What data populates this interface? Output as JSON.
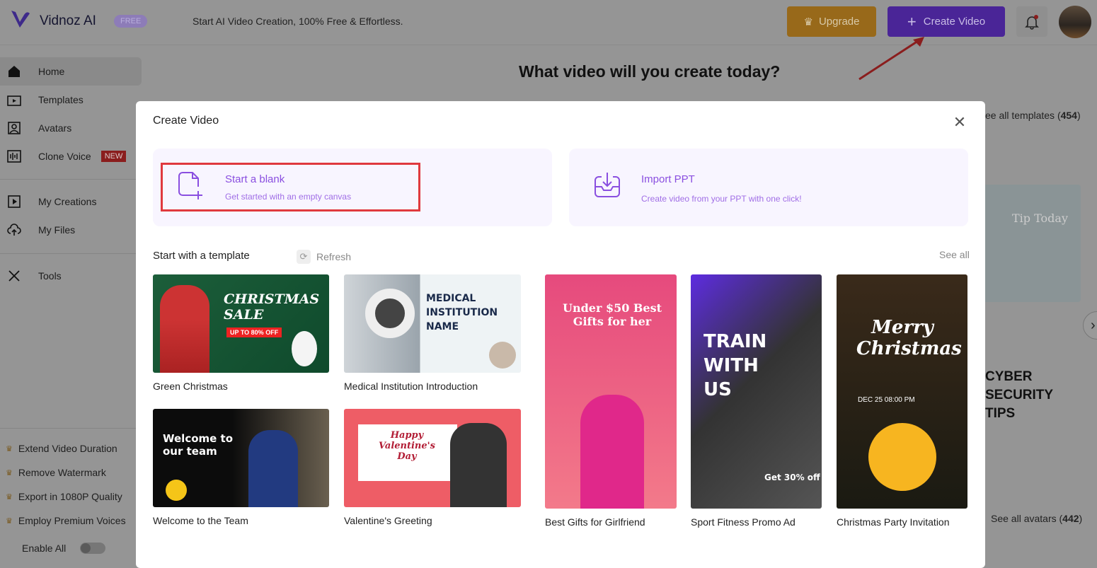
{
  "header": {
    "brand": "Vidnoz AI",
    "badge": "FREE",
    "tagline": "Start AI Video Creation, 100% Free & Effortless.",
    "upgrade": "Upgrade",
    "create_video": "Create Video"
  },
  "sidebar": {
    "items": [
      {
        "label": "Home",
        "icon": "home-icon"
      },
      {
        "label": "Templates",
        "icon": "templates-icon"
      },
      {
        "label": "Avatars",
        "icon": "avatar-icon"
      },
      {
        "label": "Clone Voice",
        "icon": "voice-icon",
        "badge": "NEW"
      },
      {
        "label": "My Creations",
        "icon": "play-icon"
      },
      {
        "label": "My Files",
        "icon": "upload-cloud-icon"
      },
      {
        "label": "Tools",
        "icon": "tools-icon"
      }
    ],
    "perks": [
      "Extend Video Duration",
      "Remove Watermark",
      "Export in 1080P Quality",
      "Employ Premium Voices"
    ],
    "enable_all": "Enable All",
    "enable_all_on": false
  },
  "background": {
    "title": "What video will you create today?",
    "see_templates": "ee all templates (",
    "templates_count": "454",
    "see_avatars": "See all avatars (",
    "avatars_count": "442",
    "close_paren": ")",
    "tip": "Tip Today",
    "cyber": "CYBER SECURITY TIPS"
  },
  "modal": {
    "title": "Create Video",
    "options": [
      {
        "title": "Start a blank",
        "subtitle": "Get started with an empty canvas"
      },
      {
        "title": "Import PPT",
        "subtitle": "Create video from your PPT with one click!"
      }
    ],
    "section_title": "Start with a template",
    "refresh": "Refresh",
    "see_all": "See all",
    "templates": [
      {
        "name": "Green Christmas",
        "thumb_text": "CHRISTMAS SALE",
        "sub": "UP TO 80% OFF"
      },
      {
        "name": "Medical Institution Introduction",
        "thumb_text": "MEDICAL INSTITUTION NAME"
      },
      {
        "name": "Welcome to the Team",
        "thumb_text": "Welcome to our team"
      },
      {
        "name": "Valentine's Greeting",
        "thumb_text": "Happy Valentine's Day"
      },
      {
        "name": "Best Gifts for Girlfriend",
        "thumb_text": "Under $50 Best Gifts for her"
      },
      {
        "name": "Sport Fitness Promo Ad",
        "thumb_text": "TRAIN WITH US",
        "sub": "Get 30% off"
      },
      {
        "name": "Christmas Party Invitation",
        "thumb_text": "Merry Christmas",
        "sub": "DEC 25 08:00 PM"
      }
    ]
  },
  "colors": {
    "accent": "#7b3fe4",
    "highlight": "#e0393e",
    "upgrade": "#e8a12c"
  }
}
